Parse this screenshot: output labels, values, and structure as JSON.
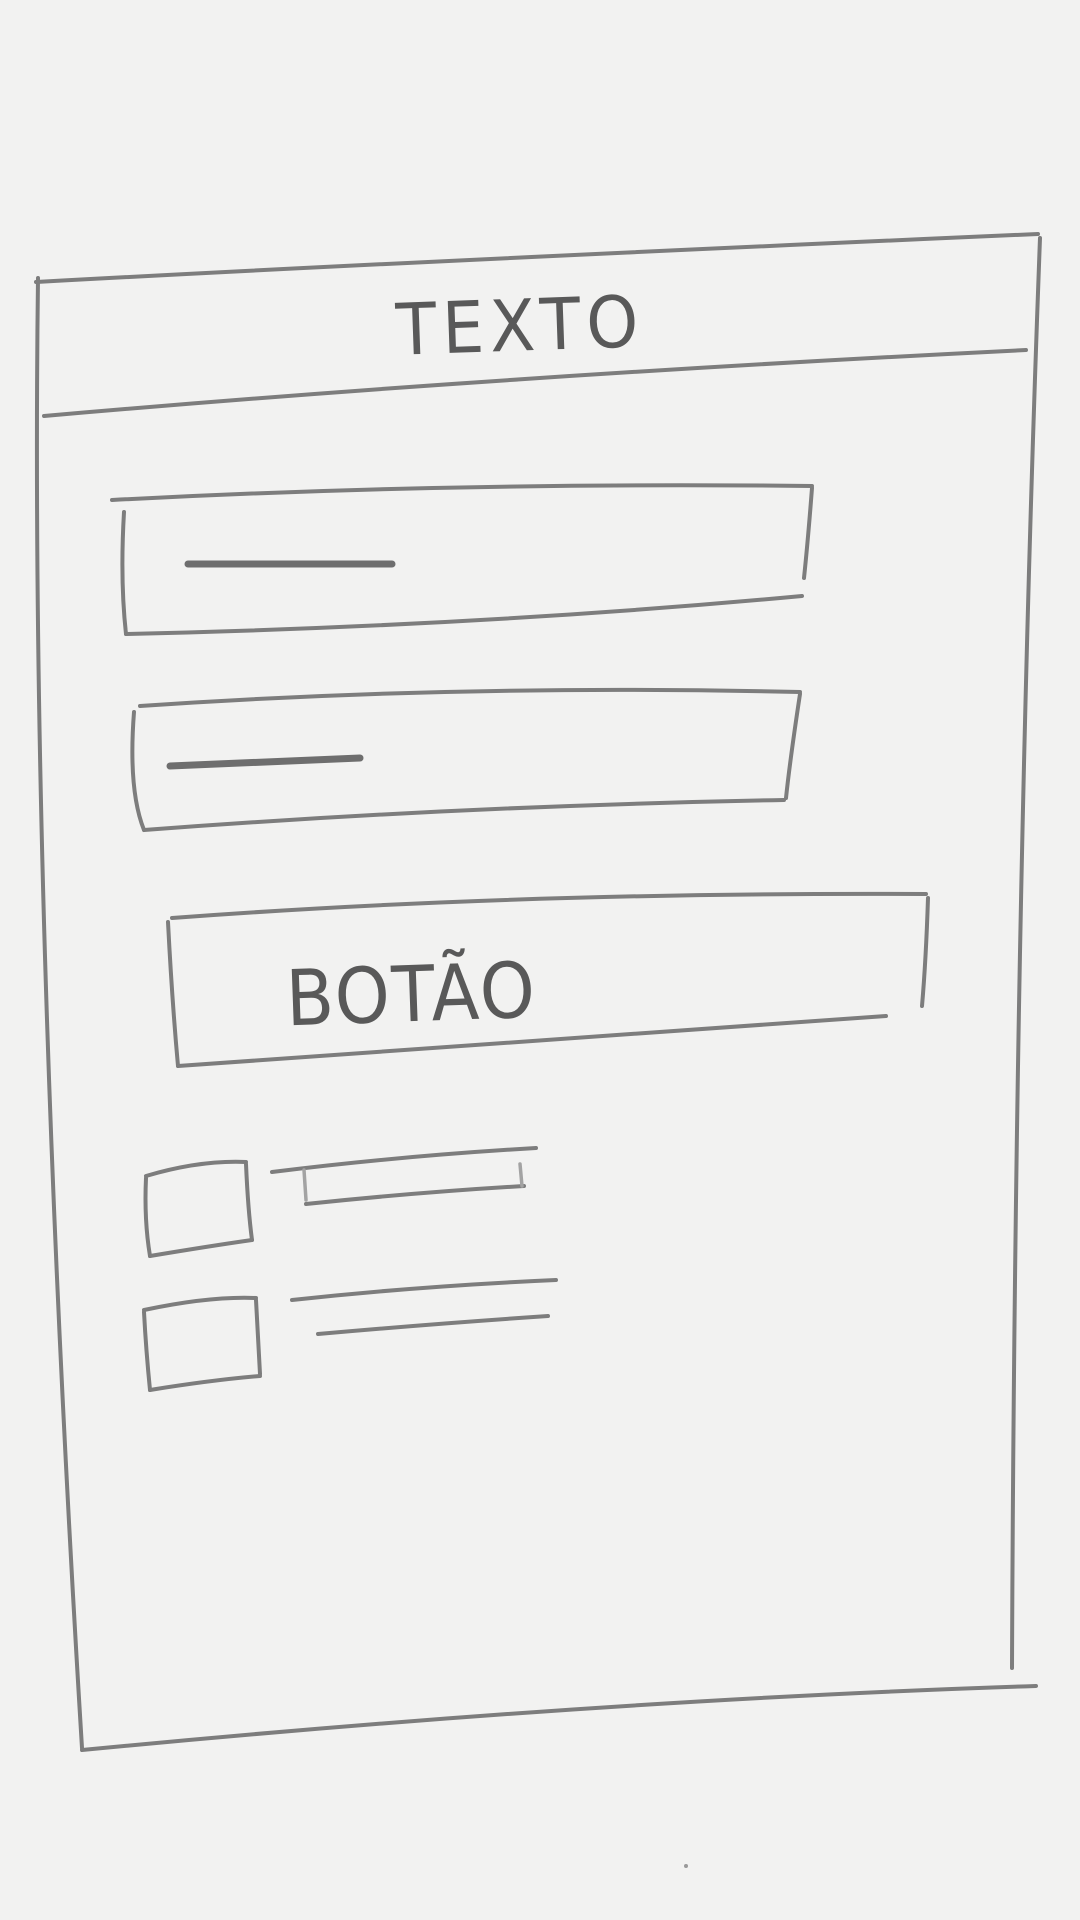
{
  "header": {
    "title": "TEXTO"
  },
  "form": {
    "input_1": {
      "value": ""
    },
    "input_2": {
      "value": ""
    },
    "button_label": "BOTÃO",
    "checkboxes": [
      {
        "checked": false,
        "label": ""
      },
      {
        "checked": false,
        "label": ""
      }
    ]
  },
  "colors": {
    "paper": "#f2f2f1",
    "pencil": "#7d7d7d"
  }
}
